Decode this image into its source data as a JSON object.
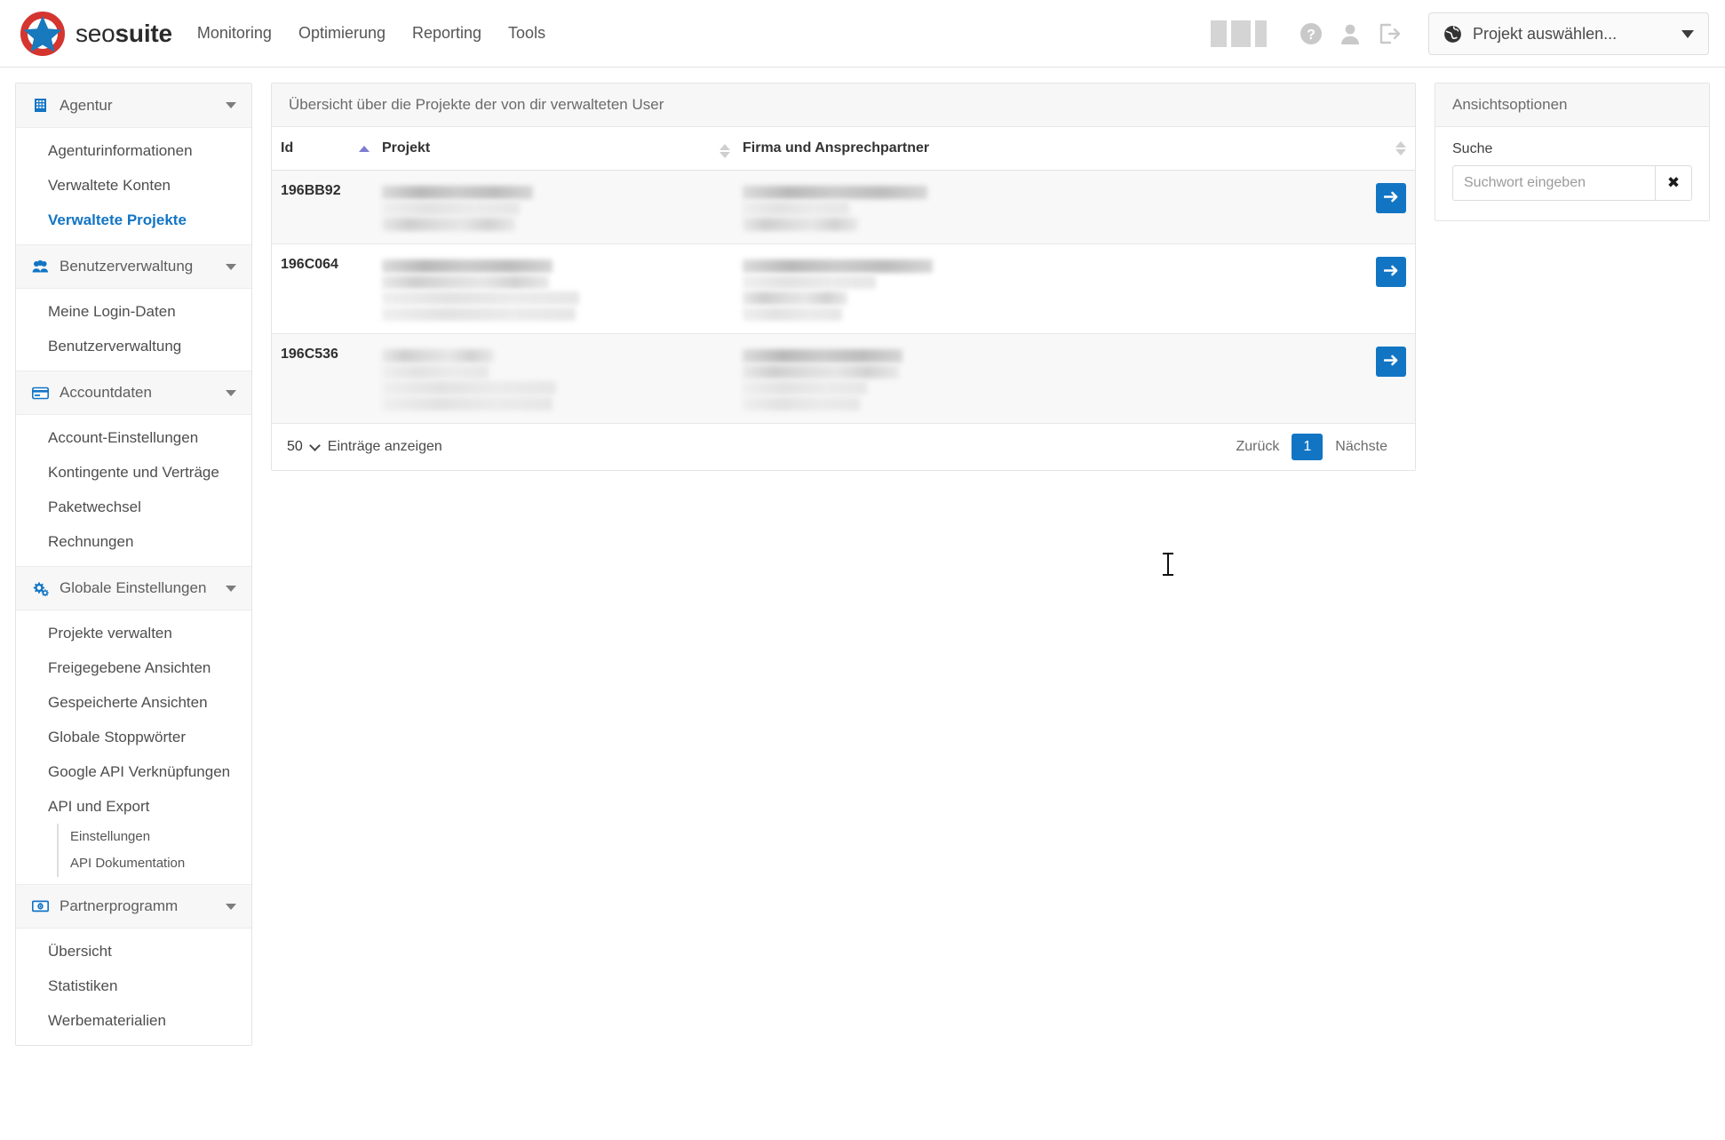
{
  "brand": {
    "name_light": "seo",
    "name_bold": "suite",
    "logo_icon": "star-badge-logo"
  },
  "topnav": [
    {
      "label": "Monitoring"
    },
    {
      "label": "Optimierung"
    },
    {
      "label": "Reporting"
    },
    {
      "label": "Tools"
    }
  ],
  "header_icons": [
    {
      "name": "help-icon",
      "glyph": "?"
    },
    {
      "name": "user-icon",
      "glyph": "user"
    },
    {
      "name": "logout-icon",
      "glyph": "logout"
    }
  ],
  "project_select": {
    "label": "Projekt auswählen...",
    "icon": "globe-icon"
  },
  "sidebar": {
    "groups": [
      {
        "label": "Agentur",
        "icon": "building-icon",
        "items": [
          {
            "label": "Agenturinformationen",
            "active": false
          },
          {
            "label": "Verwaltete Konten",
            "active": false
          },
          {
            "label": "Verwaltete Projekte",
            "active": true
          }
        ]
      },
      {
        "label": "Benutzerverwaltung",
        "icon": "users-icon",
        "items": [
          {
            "label": "Meine Login-Daten",
            "active": false
          },
          {
            "label": "Benutzerverwaltung",
            "active": false
          }
        ]
      },
      {
        "label": "Accountdaten",
        "icon": "credit-card-icon",
        "items": [
          {
            "label": "Account-Einstellungen",
            "active": false
          },
          {
            "label": "Kontingente und Verträge",
            "active": false
          },
          {
            "label": "Paketwechsel",
            "active": false
          },
          {
            "label": "Rechnungen",
            "active": false
          }
        ]
      },
      {
        "label": "Globale Einstellungen",
        "icon": "gears-icon",
        "items": [
          {
            "label": "Projekte verwalten",
            "active": false
          },
          {
            "label": "Freigegebene Ansichten",
            "active": false
          },
          {
            "label": "Gespeicherte Ansichten",
            "active": false
          },
          {
            "label": "Globale Stoppwörter",
            "active": false
          },
          {
            "label": "Google API Verknüpfungen",
            "active": false
          },
          {
            "label": "API und Export",
            "active": false,
            "subitems": [
              {
                "label": "Einstellungen"
              },
              {
                "label": "API Dokumentation"
              }
            ]
          }
        ]
      },
      {
        "label": "Partnerprogramm",
        "icon": "banknote-icon",
        "items": [
          {
            "label": "Übersicht",
            "active": false
          },
          {
            "label": "Statistiken",
            "active": false
          },
          {
            "label": "Werbematerialien",
            "active": false
          }
        ]
      }
    ]
  },
  "main": {
    "card_title": "Übersicht über die Projekte der von dir verwalteten User",
    "columns": [
      {
        "key": "id",
        "label": "Id",
        "sort": "asc"
      },
      {
        "key": "projekt",
        "label": "Projekt",
        "sort": "none"
      },
      {
        "key": "firma",
        "label": "Firma und Ansprechpartner",
        "sort": "none"
      },
      {
        "key": "action",
        "label": "",
        "sort": null
      }
    ],
    "rows": [
      {
        "id": "196BB92",
        "projekt": "redacted",
        "firma": "redacted",
        "action_icon": "arrow-right-icon"
      },
      {
        "id": "196C064",
        "projekt": "redacted",
        "firma": "redacted",
        "action_icon": "arrow-right-icon"
      },
      {
        "id": "196C536",
        "projekt": "redacted",
        "firma": "redacted",
        "action_icon": "arrow-right-icon"
      }
    ],
    "footer": {
      "page_length": "50",
      "page_length_label": "Einträge anzeigen",
      "prev_label": "Zurück",
      "current_page": "1",
      "next_label": "Nächste"
    }
  },
  "right_panel": {
    "title": "Ansichtsoptionen",
    "search_label": "Suche",
    "search_value": "",
    "search_placeholder": "Suchwort eingeben",
    "clear_glyph": "✖"
  },
  "colors": {
    "accent": "#1275c4",
    "logo_red": "#d5352f",
    "logo_blue": "#1879bd",
    "sort_active": "#7b7bd1",
    "panel_bg": "#f7f7f7",
    "border": "#e4e4e4"
  }
}
